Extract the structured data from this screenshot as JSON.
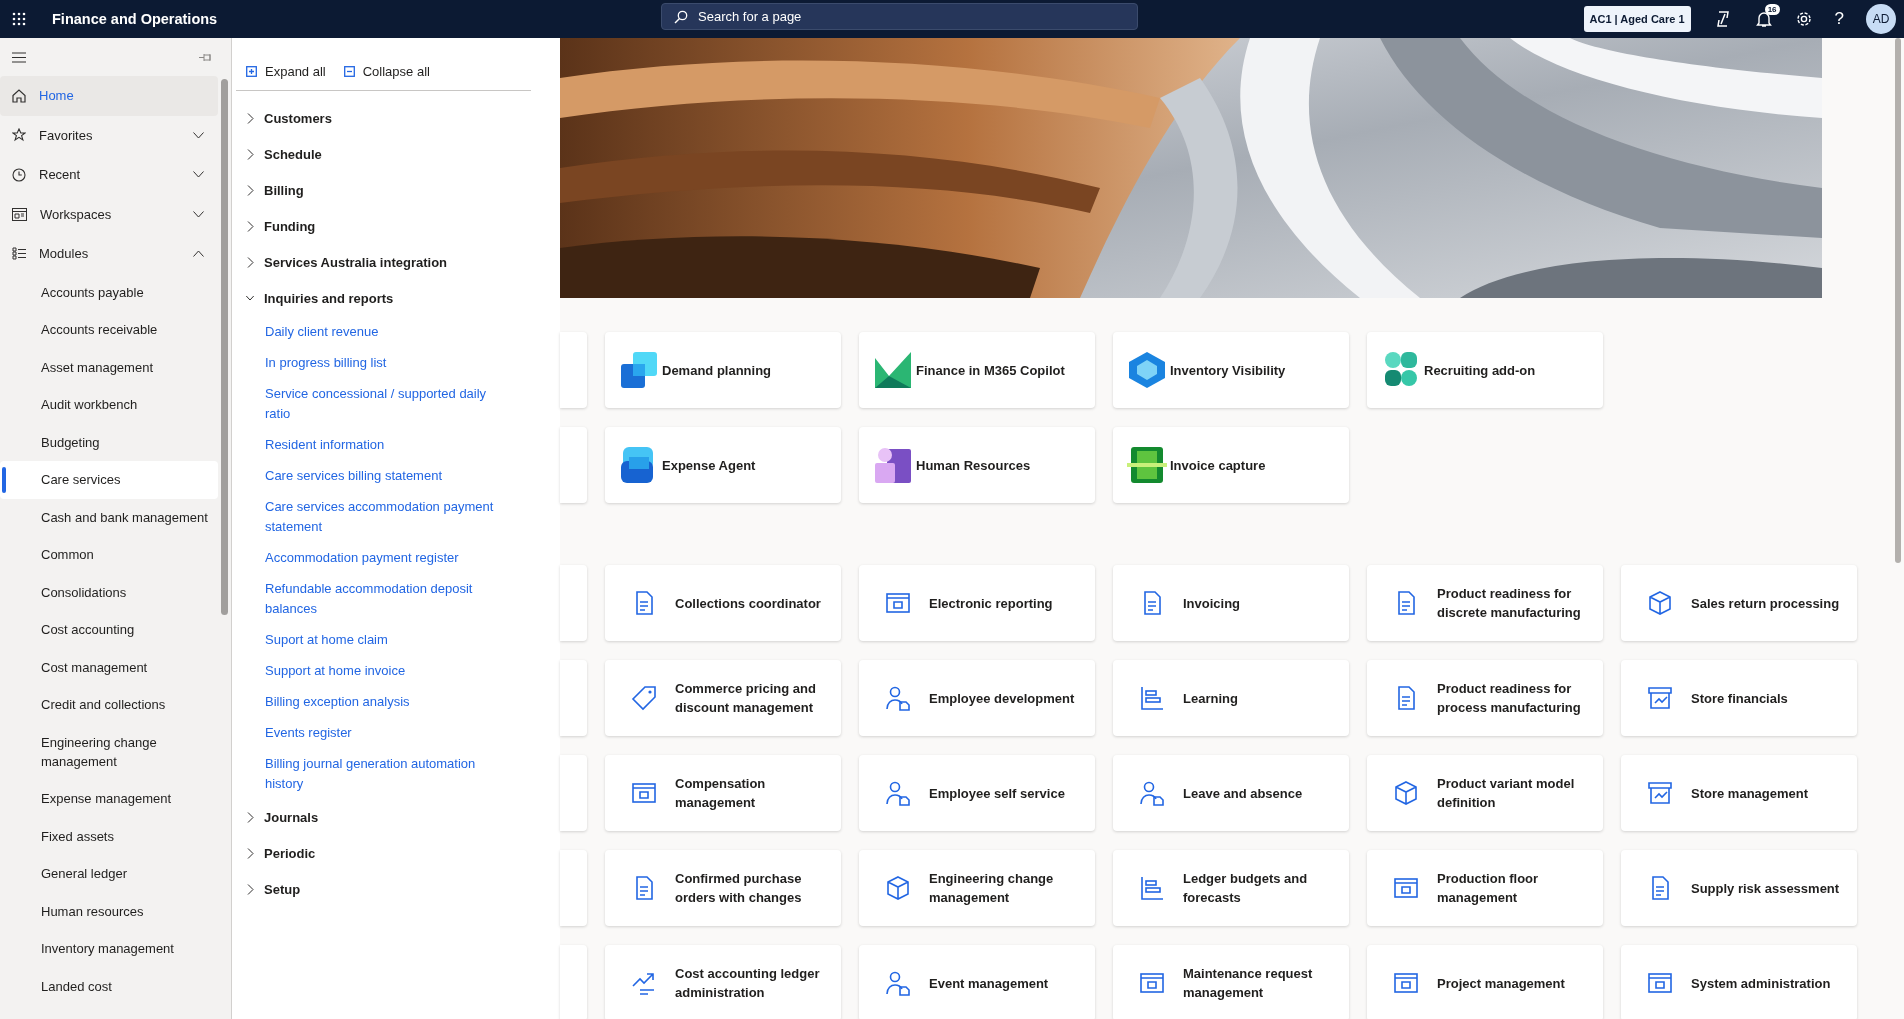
{
  "topbar": {
    "title": "Finance and Operations",
    "search": {
      "placeholder": "Search for a page"
    },
    "company": "AC1 | Aged Care 1",
    "notification_count": "16",
    "help": "?",
    "avatar": "AD"
  },
  "nav": {
    "items": [
      {
        "label": "Home",
        "kind": "home",
        "selected": true
      },
      {
        "label": "Favorites",
        "kind": "favorites",
        "selected": false,
        "expanded": false
      },
      {
        "label": "Recent",
        "kind": "recent",
        "selected": false,
        "expanded": false
      },
      {
        "label": "Workspaces",
        "kind": "workspaces",
        "selected": false,
        "expanded": false
      },
      {
        "label": "Modules",
        "kind": "modules",
        "selected": false,
        "expanded": true
      }
    ],
    "modules": [
      {
        "label": "Accounts payable",
        "selected": false
      },
      {
        "label": "Accounts receivable",
        "selected": false
      },
      {
        "label": "Asset management",
        "selected": false
      },
      {
        "label": "Audit workbench",
        "selected": false
      },
      {
        "label": "Budgeting",
        "selected": false
      },
      {
        "label": "Care services",
        "selected": true
      },
      {
        "label": "Cash and bank management",
        "selected": false
      },
      {
        "label": "Common",
        "selected": false
      },
      {
        "label": "Consolidations",
        "selected": false
      },
      {
        "label": "Cost accounting",
        "selected": false
      },
      {
        "label": "Cost management",
        "selected": false
      },
      {
        "label": "Credit and collections",
        "selected": false
      },
      {
        "label": "Engineering change management",
        "selected": false
      },
      {
        "label": "Expense management",
        "selected": false
      },
      {
        "label": "Fixed assets",
        "selected": false
      },
      {
        "label": "General ledger",
        "selected": false
      },
      {
        "label": "Human resources",
        "selected": false
      },
      {
        "label": "Inventory management",
        "selected": false
      },
      {
        "label": "Landed cost",
        "selected": false
      }
    ]
  },
  "flyout": {
    "expand_all": "Expand all",
    "collapse_all": "Collapse all",
    "groups": [
      {
        "label": "Customers",
        "expanded": false
      },
      {
        "label": "Schedule",
        "expanded": false
      },
      {
        "label": "Billing",
        "expanded": false
      },
      {
        "label": "Funding",
        "expanded": false
      },
      {
        "label": "Services Australia integration",
        "expanded": false
      },
      {
        "label": "Inquiries and reports",
        "expanded": true,
        "links": [
          "Daily client revenue",
          "In progress billing list",
          "Service concessional / supported daily ratio",
          "Resident information",
          "Care services billing statement",
          "Care services accommodation payment statement",
          "Accommodation payment register",
          "Refundable accommodation deposit balances",
          "Suport at home claim",
          "Support at home invoice",
          "Billing exception analysis",
          "Events register",
          "Billing journal generation automation history"
        ]
      },
      {
        "label": "Journals",
        "expanded": false
      },
      {
        "label": "Periodic",
        "expanded": false
      },
      {
        "label": "Setup",
        "expanded": false
      }
    ]
  },
  "banner": {
    "kind": "picture"
  },
  "app_tiles": [
    [
      "Demand planning",
      "Finance in M365 Copilot",
      "Inventory Visibility",
      "Recruiting add-on"
    ],
    [
      "Expense Agent",
      "Human Resources",
      "Invoice capture"
    ]
  ],
  "workspace_tiles": [
    [
      "Collections coordinator",
      "Electronic reporting",
      "Invoicing",
      "Product readiness for discrete manufacturing",
      "Sales return processing"
    ],
    [
      "Commerce pricing and discount management",
      "Employee development",
      "Learning",
      "Product readiness for process manufacturing",
      "Store financials"
    ],
    [
      "Compensation management",
      "Employee self service",
      "Leave and absence",
      "Product variant model definition",
      "Store management"
    ],
    [
      "Confirmed purchase orders with changes",
      "Engineering change management",
      "Ledger budgets and forecasts",
      "Production floor management",
      "Supply risk assessment"
    ],
    [
      "Cost accounting ledger administration",
      "Event management",
      "Maintenance request management",
      "Project management",
      "System administration"
    ]
  ]
}
